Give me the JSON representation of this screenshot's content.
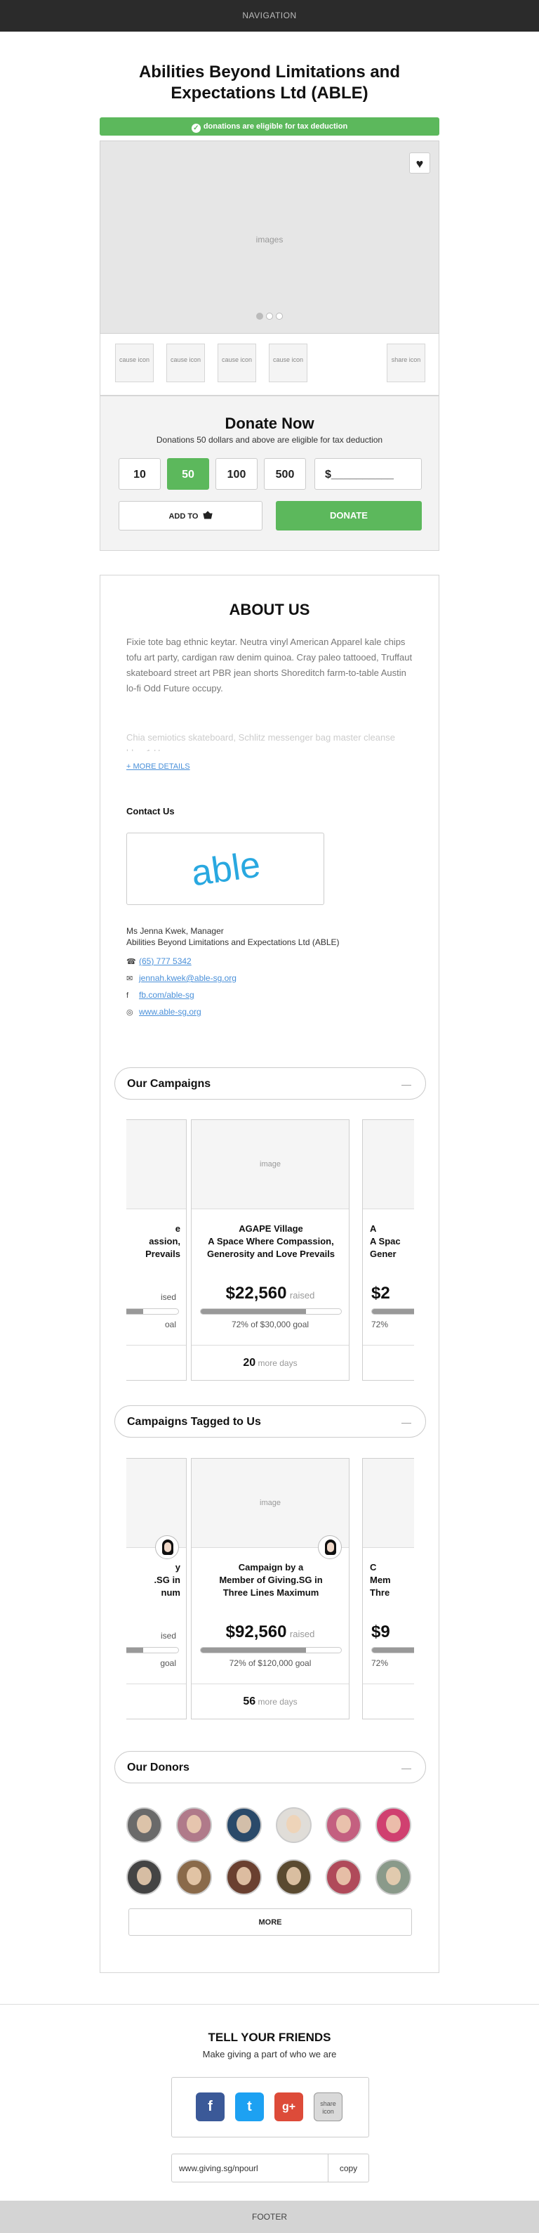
{
  "nav": {
    "label": "NAVIGATION"
  },
  "org": {
    "title": "Abilities Beyond Limitations and Expectations Ltd (ABLE)"
  },
  "tax_banner": "donations are eligible for tax deduction",
  "gallery": {
    "placeholder": "images",
    "icon": "heart-icon"
  },
  "cause_icons": [
    "cause icon",
    "cause icon",
    "cause icon",
    "cause icon"
  ],
  "share_icon": "share icon",
  "donate": {
    "title": "Donate Now",
    "subtitle": "Donations 50 dollars  and above are eligible for tax deduction",
    "amounts": [
      "10",
      "50",
      "100",
      "500"
    ],
    "selected": "50",
    "custom": "$__________",
    "add_to_label": "ADD TO",
    "add_to_icon": "basket-icon",
    "donate_label": "DONATE",
    "accent": "#5cb85c"
  },
  "about": {
    "title": "ABOUT US",
    "text": "Fixie tote bag ethnic keytar. Neutra vinyl American Apparel kale chips tofu art party, cardigan raw denim quinoa. Cray paleo tattooed, Truffaut skateboard street art PBR jean shorts Shoreditch farm-to-table Austin lo-fi Odd Future occupy.",
    "text_faded": "Chia semiotics skateboard, Schlitz messenger bag master cleanse blog 1 Ho",
    "more_details": "+ MORE DETAILS"
  },
  "contact": {
    "heading": "Contact Us",
    "logo_text": "able",
    "name": "Ms Jenna Kwek, Manager",
    "org": "Abilities Beyond Limitations and Expectations Ltd (ABLE)",
    "phone": "(65) 777 5342",
    "email": "jennah.kwek@able-sg.org",
    "facebook": "fb.com/able-sg",
    "website": "www.able-sg.org"
  },
  "our_campaigns": {
    "heading": "Our Campaigns",
    "toggle": "—",
    "main": {
      "image": "image",
      "title": "AGAPE Village\nA Space Where Compassion, Generosity and Love Prevails",
      "amount": "$22,560",
      "raised": "raised",
      "progress": 0.75,
      "goal": "72% of $30,000 goal",
      "days": "20",
      "days_label": "more days"
    },
    "left_peek": {
      "title": "e\nassion,\nPrevails",
      "raised": "ised",
      "goal": "oal"
    },
    "right_peek": {
      "title": "A\nA Spac\nGener",
      "amount": "$2",
      "goal": "72%"
    }
  },
  "tagged_campaigns": {
    "heading": "Campaigns Tagged to Us",
    "toggle": "—",
    "main": {
      "image": "image",
      "title": "Campaign by a\nMember of Giving.SG in\nThree Lines Maximum",
      "amount": "$92,560",
      "raised": "raised",
      "progress": 0.75,
      "goal": "72% of $120,000 goal",
      "days": "56",
      "days_label": "more days"
    },
    "left_peek": {
      "title": "y\n.SG in\nnum",
      "raised": "ised",
      "goal": "goal"
    },
    "right_peek": {
      "title": "C\nMem\nThre",
      "amount": "$9",
      "goal": "72%"
    }
  },
  "donors": {
    "heading": "Our Donors",
    "toggle": "—",
    "more": "MORE",
    "colors": [
      "#6a6a6a",
      "#b07a8a",
      "#2a4a6a",
      "#e0ddd8",
      "#c46080",
      "#d04070",
      "#444444",
      "#8a6a4a",
      "#6a4030",
      "#5a4a30",
      "#b04a5a",
      "#8a9a8a"
    ]
  },
  "share": {
    "heading": "TELL YOUR FRIENDS",
    "subheading": "Make giving a part of who we are",
    "fb": "f",
    "tw": "t",
    "gp": "g+",
    "share_label": "share icon",
    "url": "www.giving.sg/npourl",
    "copy": "copy"
  },
  "footer": "FOOTER"
}
